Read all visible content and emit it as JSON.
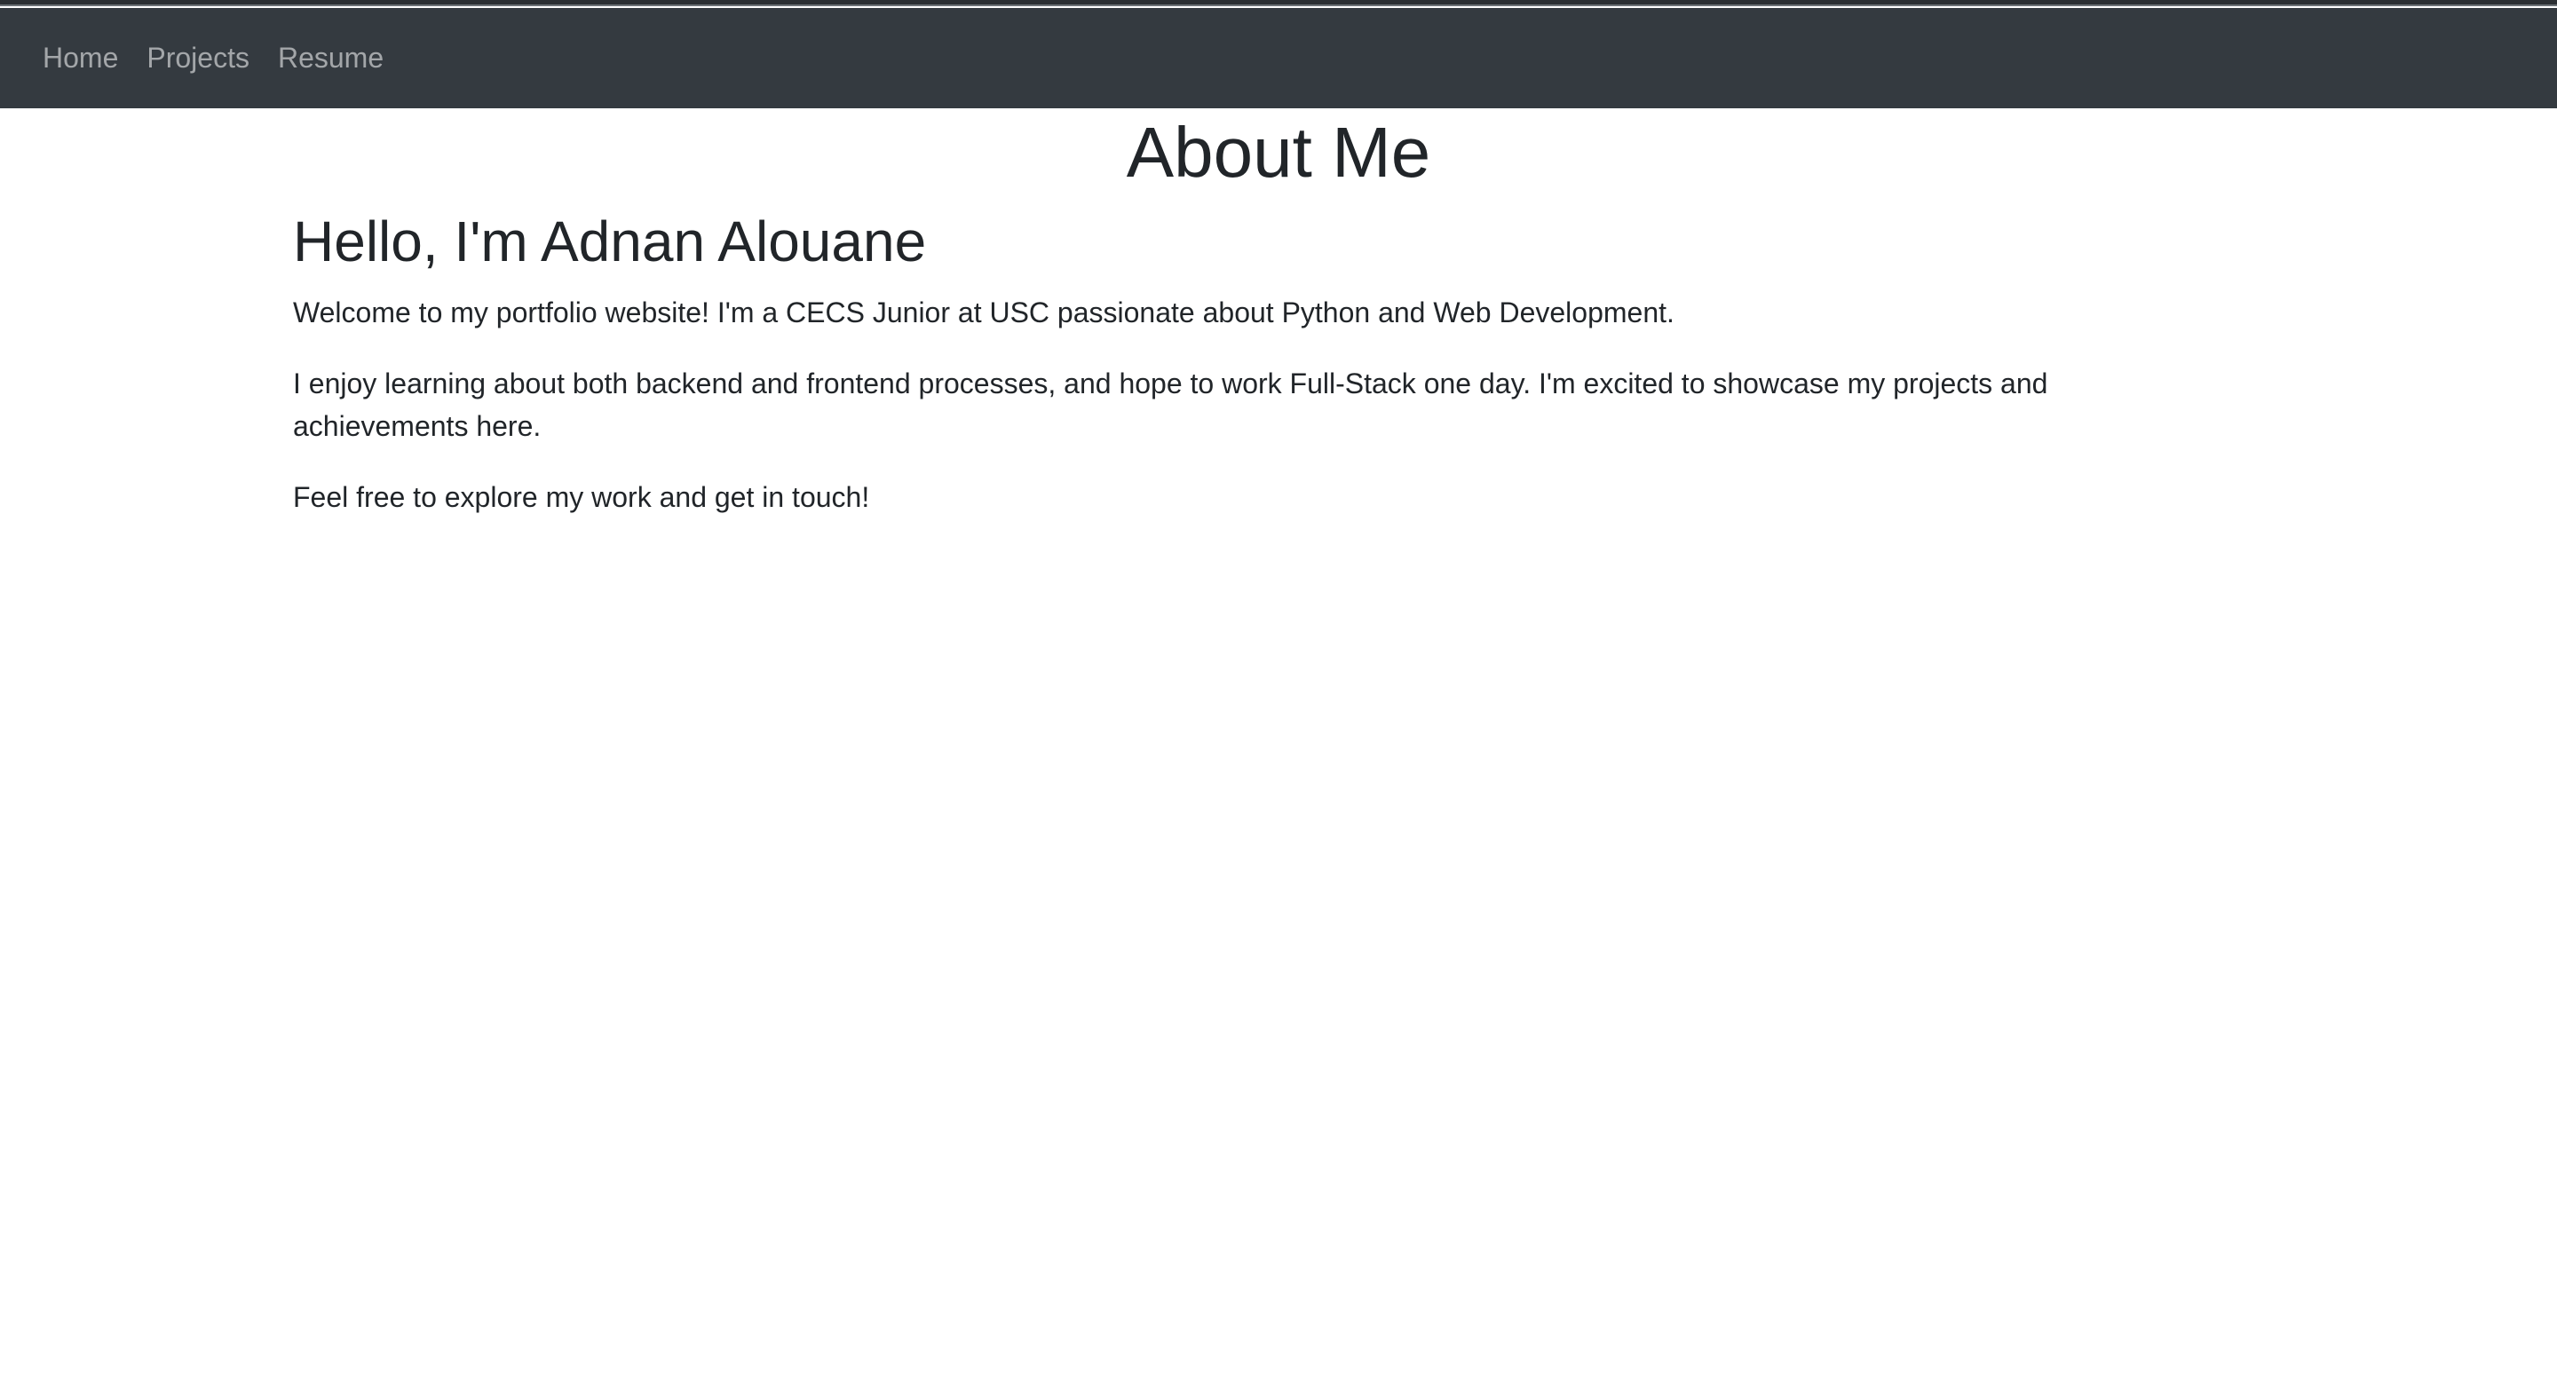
{
  "nav": {
    "items": [
      {
        "label": "Home"
      },
      {
        "label": "Projects"
      },
      {
        "label": "Resume"
      }
    ]
  },
  "page": {
    "title": "About Me",
    "greeting": "Hello, I'm Adnan Alouane",
    "paragraphs": [
      "Welcome to my portfolio website! I'm a CECS Junior at USC passionate about Python and Web Development.",
      "I enjoy learning about both backend and frontend processes, and hope to work Full-Stack one day. I'm excited to showcase my projects and achievements here.",
      "Feel free to explore my work and get in touch!"
    ]
  },
  "colors": {
    "navbar_bg": "#343a40",
    "nav_link": "#9da0a4",
    "text": "#212529",
    "background": "#ffffff"
  }
}
